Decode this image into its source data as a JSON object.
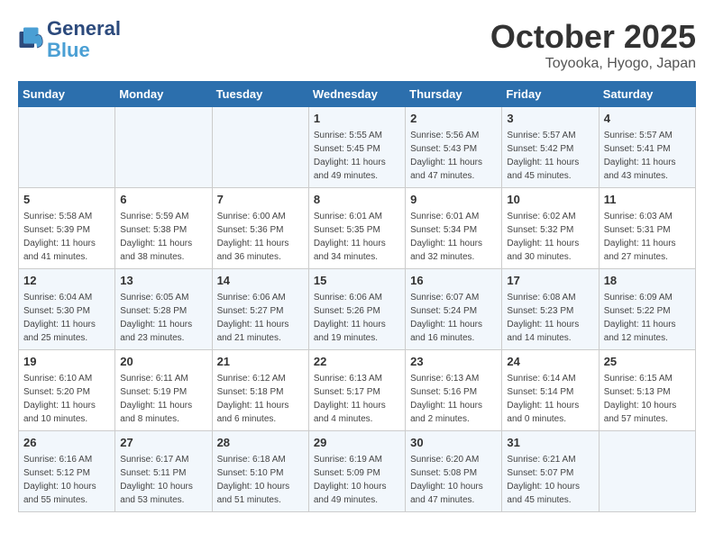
{
  "header": {
    "logo_line1": "General",
    "logo_line2": "Blue",
    "month_title": "October 2025",
    "location": "Toyooka, Hyogo, Japan"
  },
  "weekdays": [
    "Sunday",
    "Monday",
    "Tuesday",
    "Wednesday",
    "Thursday",
    "Friday",
    "Saturday"
  ],
  "weeks": [
    [
      {
        "day": "",
        "info": ""
      },
      {
        "day": "",
        "info": ""
      },
      {
        "day": "",
        "info": ""
      },
      {
        "day": "1",
        "info": "Sunrise: 5:55 AM\nSunset: 5:45 PM\nDaylight: 11 hours\nand 49 minutes."
      },
      {
        "day": "2",
        "info": "Sunrise: 5:56 AM\nSunset: 5:43 PM\nDaylight: 11 hours\nand 47 minutes."
      },
      {
        "day": "3",
        "info": "Sunrise: 5:57 AM\nSunset: 5:42 PM\nDaylight: 11 hours\nand 45 minutes."
      },
      {
        "day": "4",
        "info": "Sunrise: 5:57 AM\nSunset: 5:41 PM\nDaylight: 11 hours\nand 43 minutes."
      }
    ],
    [
      {
        "day": "5",
        "info": "Sunrise: 5:58 AM\nSunset: 5:39 PM\nDaylight: 11 hours\nand 41 minutes."
      },
      {
        "day": "6",
        "info": "Sunrise: 5:59 AM\nSunset: 5:38 PM\nDaylight: 11 hours\nand 38 minutes."
      },
      {
        "day": "7",
        "info": "Sunrise: 6:00 AM\nSunset: 5:36 PM\nDaylight: 11 hours\nand 36 minutes."
      },
      {
        "day": "8",
        "info": "Sunrise: 6:01 AM\nSunset: 5:35 PM\nDaylight: 11 hours\nand 34 minutes."
      },
      {
        "day": "9",
        "info": "Sunrise: 6:01 AM\nSunset: 5:34 PM\nDaylight: 11 hours\nand 32 minutes."
      },
      {
        "day": "10",
        "info": "Sunrise: 6:02 AM\nSunset: 5:32 PM\nDaylight: 11 hours\nand 30 minutes."
      },
      {
        "day": "11",
        "info": "Sunrise: 6:03 AM\nSunset: 5:31 PM\nDaylight: 11 hours\nand 27 minutes."
      }
    ],
    [
      {
        "day": "12",
        "info": "Sunrise: 6:04 AM\nSunset: 5:30 PM\nDaylight: 11 hours\nand 25 minutes."
      },
      {
        "day": "13",
        "info": "Sunrise: 6:05 AM\nSunset: 5:28 PM\nDaylight: 11 hours\nand 23 minutes."
      },
      {
        "day": "14",
        "info": "Sunrise: 6:06 AM\nSunset: 5:27 PM\nDaylight: 11 hours\nand 21 minutes."
      },
      {
        "day": "15",
        "info": "Sunrise: 6:06 AM\nSunset: 5:26 PM\nDaylight: 11 hours\nand 19 minutes."
      },
      {
        "day": "16",
        "info": "Sunrise: 6:07 AM\nSunset: 5:24 PM\nDaylight: 11 hours\nand 16 minutes."
      },
      {
        "day": "17",
        "info": "Sunrise: 6:08 AM\nSunset: 5:23 PM\nDaylight: 11 hours\nand 14 minutes."
      },
      {
        "day": "18",
        "info": "Sunrise: 6:09 AM\nSunset: 5:22 PM\nDaylight: 11 hours\nand 12 minutes."
      }
    ],
    [
      {
        "day": "19",
        "info": "Sunrise: 6:10 AM\nSunset: 5:20 PM\nDaylight: 11 hours\nand 10 minutes."
      },
      {
        "day": "20",
        "info": "Sunrise: 6:11 AM\nSunset: 5:19 PM\nDaylight: 11 hours\nand 8 minutes."
      },
      {
        "day": "21",
        "info": "Sunrise: 6:12 AM\nSunset: 5:18 PM\nDaylight: 11 hours\nand 6 minutes."
      },
      {
        "day": "22",
        "info": "Sunrise: 6:13 AM\nSunset: 5:17 PM\nDaylight: 11 hours\nand 4 minutes."
      },
      {
        "day": "23",
        "info": "Sunrise: 6:13 AM\nSunset: 5:16 PM\nDaylight: 11 hours\nand 2 minutes."
      },
      {
        "day": "24",
        "info": "Sunrise: 6:14 AM\nSunset: 5:14 PM\nDaylight: 11 hours\nand 0 minutes."
      },
      {
        "day": "25",
        "info": "Sunrise: 6:15 AM\nSunset: 5:13 PM\nDaylight: 10 hours\nand 57 minutes."
      }
    ],
    [
      {
        "day": "26",
        "info": "Sunrise: 6:16 AM\nSunset: 5:12 PM\nDaylight: 10 hours\nand 55 minutes."
      },
      {
        "day": "27",
        "info": "Sunrise: 6:17 AM\nSunset: 5:11 PM\nDaylight: 10 hours\nand 53 minutes."
      },
      {
        "day": "28",
        "info": "Sunrise: 6:18 AM\nSunset: 5:10 PM\nDaylight: 10 hours\nand 51 minutes."
      },
      {
        "day": "29",
        "info": "Sunrise: 6:19 AM\nSunset: 5:09 PM\nDaylight: 10 hours\nand 49 minutes."
      },
      {
        "day": "30",
        "info": "Sunrise: 6:20 AM\nSunset: 5:08 PM\nDaylight: 10 hours\nand 47 minutes."
      },
      {
        "day": "31",
        "info": "Sunrise: 6:21 AM\nSunset: 5:07 PM\nDaylight: 10 hours\nand 45 minutes."
      },
      {
        "day": "",
        "info": ""
      }
    ]
  ]
}
